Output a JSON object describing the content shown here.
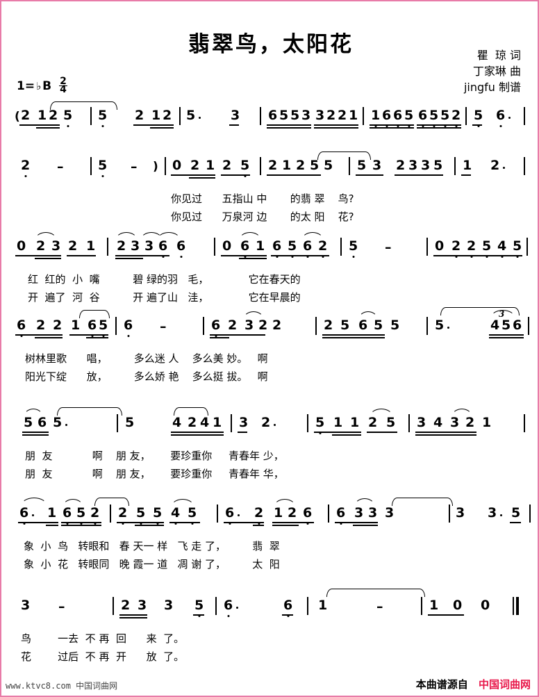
{
  "title": "翡翠鸟，太阳花",
  "credits": {
    "lyricist": "瞿  琼 词",
    "composer": "丁家琳 曲",
    "engraver": "jingfu 制谱"
  },
  "key": {
    "prefix": "1=",
    "flat": "♭",
    "note": "B",
    "meter_num": "2",
    "meter_den": "4"
  },
  "systems": [
    {
      "id": "system-1",
      "notes": [
        "(2",
        "1",
        "2",
        "5",
        "5",
        "2",
        "1",
        "2",
        "5·",
        "3",
        "6",
        "5",
        "5",
        "3",
        "3",
        "2",
        "2",
        "1",
        "1",
        "6",
        "6",
        "5",
        "6",
        "5",
        "5",
        "2",
        "5",
        "6·"
      ],
      "lyrics_1": "",
      "lyrics_2": ""
    },
    {
      "id": "system-2",
      "notes": [
        "2",
        "–",
        "5",
        "–",
        ")",
        "0",
        "2",
        "1",
        "2",
        "5",
        "2",
        "1",
        "2",
        "5",
        "5",
        "5",
        "3",
        "2",
        "3",
        "3",
        "5",
        "1",
        "2·"
      ],
      "lyrics_1": "你见过      五指山 中       的翡 翠    鸟?",
      "lyrics_2": "你见过      万泉河 边       的太 阳    花?"
    },
    {
      "id": "system-3",
      "notes": [
        "0",
        "2",
        "3",
        "2",
        "1",
        "2",
        "3",
        "3",
        "6",
        "6",
        "0",
        "6",
        "1",
        "6",
        "5",
        "6",
        "2",
        "5",
        "–",
        "0",
        "2",
        "2",
        "5",
        "4",
        "5"
      ],
      "lyrics_1": "红  红的  小  嘴          碧 绿的羽   毛，            它在春天的",
      "lyrics_2": "开  遍了  河  谷          开 遍了山   洼，            它在早晨的"
    },
    {
      "id": "system-4",
      "notes": [
        "6",
        "2",
        "2",
        "1",
        "6",
        "5",
        "6",
        "–",
        "6",
        "2",
        "3",
        "2",
        "2",
        "2",
        "5",
        "6",
        "5",
        "5",
        "5·",
        "4",
        "5",
        "6"
      ],
      "lyrics_1": "树林里歌      唱，        多么迷 人    多么美 妙。   啊",
      "lyrics_2": "阳光下绽      放，        多么娇 艳    多么挺 拔。   啊",
      "triplet": "3"
    },
    {
      "id": "system-5",
      "notes": [
        "5",
        "6",
        "5·",
        "5",
        "4",
        "2",
        "4",
        "1",
        "3",
        "2·",
        "5",
        "1",
        "1",
        "2",
        "5",
        "3",
        "4",
        "3",
        "2",
        "1"
      ],
      "lyrics_1": "朋  友            啊    朋 友，      要珍重你     青春年 少，",
      "lyrics_2": "朋  友            啊    朋 友，      要珍重你     青春年 华，"
    },
    {
      "id": "system-6",
      "notes": [
        "6·",
        "1",
        "6",
        "5",
        "2",
        "2",
        "5",
        "5",
        "4",
        "5",
        "6·",
        "2",
        "1",
        "2",
        "6",
        "6",
        "3",
        "3",
        "3",
        "3",
        "3·",
        "5"
      ],
      "lyrics_1": "象  小  鸟   转眼和   春 天一 样   飞 走 了，        翡  翠",
      "lyrics_2": "象  小  花   转眼同   晚 霞一 道   凋 谢 了，        太  阳"
    },
    {
      "id": "system-7",
      "notes": [
        "3",
        "–",
        "2",
        "3",
        "3",
        "5",
        "6·",
        "6",
        "1",
        "–",
        "1",
        "0",
        "0"
      ],
      "lyrics_1": "鸟        一去  不 再  回      来  了。",
      "lyrics_2": "花        过后  不 再  开      放  了。"
    }
  ],
  "footer": {
    "url": "www.ktvc8.com",
    "site_cn": "中国词曲网",
    "source_label": "本曲谱源自",
    "brand": "中国词曲网"
  }
}
